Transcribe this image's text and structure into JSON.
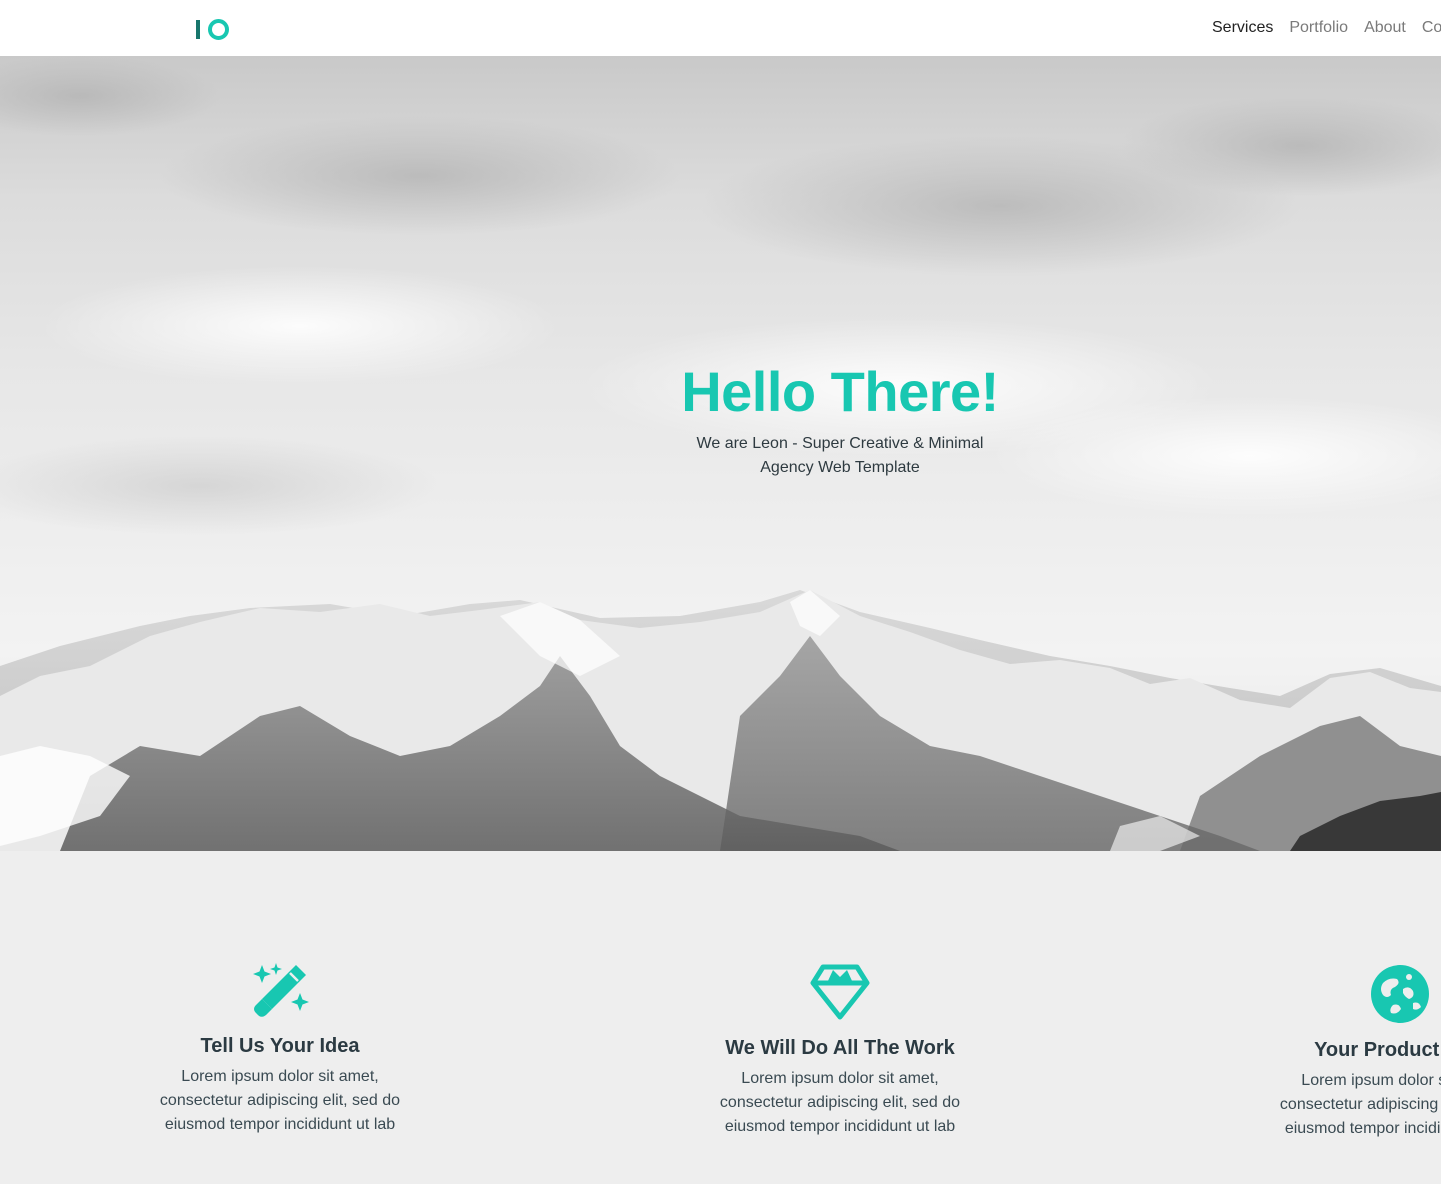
{
  "header": {
    "nav": [
      {
        "label": "Services",
        "active": true
      },
      {
        "label": "Portfolio",
        "active": false
      },
      {
        "label": "About",
        "active": false
      },
      {
        "label": "Contact",
        "active": false
      }
    ]
  },
  "hero": {
    "title": "Hello There!",
    "subtitle": "We are Leon - Super Creative & Minimal Agency Web Template"
  },
  "features": [
    {
      "icon": "magic-wand-icon",
      "title": "Tell Us Your Idea",
      "text": "Lorem ipsum dolor sit amet, consectetur adipiscing elit, sed do eiusmod tempor incididunt ut lab"
    },
    {
      "icon": "diamond-icon",
      "title": "We Will Do All The Work",
      "text": "Lorem ipsum dolor sit amet, consectetur adipiscing elit, sed do eiusmod tempor incididunt ut lab"
    },
    {
      "icon": "globe-icon",
      "title": "Your Product is W",
      "text": "Lorem ipsum dolor sit amet, consectetur adipiscing elit, sed do eiusmod tempor incididunt ut lab"
    }
  ],
  "colors": {
    "accent": "#18c7b1",
    "logo_bar": "#17766c",
    "section_bg": "#eeeeee",
    "heading_text": "#2b3a42"
  }
}
